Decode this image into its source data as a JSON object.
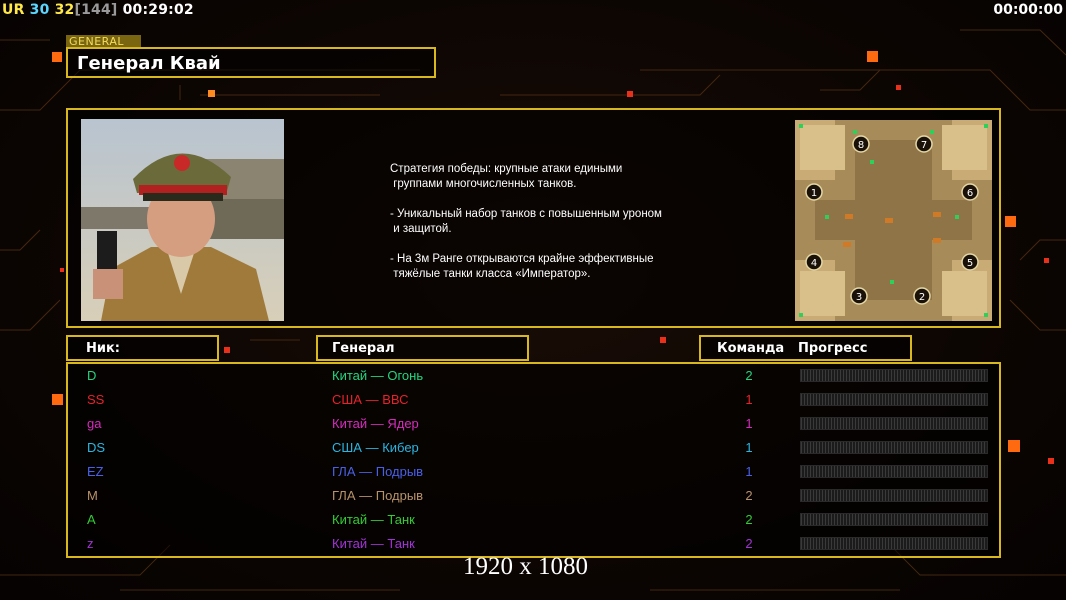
{
  "top_bar": {
    "ur_label": "UR",
    "ur_value": "30",
    "fps": "32",
    "fps_max": "[144]",
    "elapsed": "00:29:02",
    "timer": "00:00:00"
  },
  "general_panel": {
    "tag": "GENERAL",
    "name": "Генерал Квай",
    "description": "Стратегия победы: крупные атаки едиными\n группами многочисленных танков.\n\n- Уникальный набор танков с повышенным уроном\n и защитой.\n\n- На 3м Ранге открываются крайне эффективные\n тяжёлые танки класса «Император».",
    "map_slots": [
      "1",
      "2",
      "3",
      "4",
      "5",
      "6",
      "7",
      "8"
    ]
  },
  "table": {
    "header_nick": "Ник:",
    "header_general": "Генерал",
    "header_team": "Команда",
    "header_progress": "Прогресс",
    "rows": [
      {
        "nick": "D",
        "general": "Китай — Огонь",
        "team": "2",
        "color": "#22d67e",
        "progress": 0
      },
      {
        "nick": "SS",
        "general": "США — ВВС",
        "team": "1",
        "color": "#e8222a",
        "progress": 0
      },
      {
        "nick": "ga",
        "general": "Китай — Ядер",
        "team": "1",
        "color": "#d62bbd",
        "progress": 0
      },
      {
        "nick": "DS",
        "general": "США — Кибер",
        "team": "1",
        "color": "#2cb5e0",
        "progress": 0
      },
      {
        "nick": "EZ",
        "general": "ГЛА — Подрыв",
        "team": "1",
        "color": "#4a60e6",
        "progress": 0
      },
      {
        "nick": "M",
        "general": "ГЛА — Подрыв",
        "team": "2",
        "color": "#b8926a",
        "progress": 0
      },
      {
        "nick": "A",
        "general": "Китай — Танк",
        "team": "2",
        "color": "#33cc33",
        "progress": 0
      },
      {
        "nick": "z",
        "general": "Китай — Танк",
        "team": "2",
        "color": "#a233d6",
        "progress": 0
      }
    ]
  },
  "resolution_label": "1920 x 1080",
  "colors": {
    "frame": "#d8b81e",
    "accent_orange": "#ff8a1a",
    "ur": "#ffe84a",
    "ur_value": "#5bd6ff",
    "fps": "#ffe84a",
    "fps_max": "#9a9a9a"
  }
}
